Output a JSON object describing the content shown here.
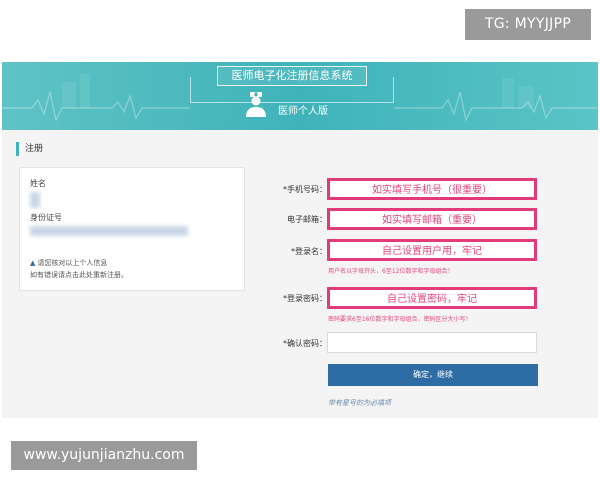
{
  "watermarks": {
    "top_right": "TG: MYYJJPP",
    "bottom_left": "www.yujunjianzhu.com"
  },
  "banner": {
    "title": "医师电子化注册信息系统",
    "subtitle": "医师个人版"
  },
  "section": {
    "title": "注册"
  },
  "info_card": {
    "name_label": "姓名",
    "id_label": "身份证号",
    "notice_line1": "请您核对以上个人信息",
    "notice_line2": "如有错误请点击此处重新注册。"
  },
  "form": {
    "phone": {
      "label": "*手机号码：",
      "hint": "如实填写手机号（很重要）"
    },
    "email": {
      "label": "电子邮箱：",
      "hint": "如实填写邮箱（重要）"
    },
    "username": {
      "label": "*登录名：",
      "hint": "自己设置用户用，牢记",
      "help": "用户名以字母开头，6至12位数字和字母组合！"
    },
    "password": {
      "label": "*登录密码：",
      "hint": "自己设置密码，牢记",
      "help": "密码要求6至16位数字和字母组合，密码区分大小写！"
    },
    "confirm": {
      "label": "*确认密码：",
      "value": ""
    },
    "submit_label": "确定，继续",
    "footnote": "带有星号的为必填项"
  },
  "colors": {
    "banner": "#3fb3b9",
    "highlight": "#e33b7a",
    "button": "#2e6da4"
  }
}
